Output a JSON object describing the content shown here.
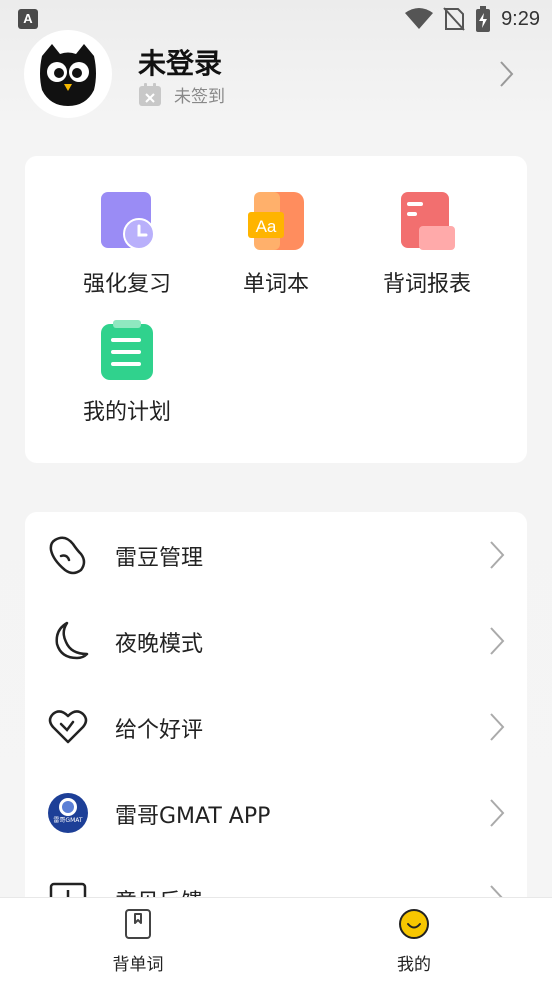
{
  "status_bar": {
    "time": "9:29",
    "app_icon": "A",
    "icons": [
      "wifi-icon",
      "no-sim-icon",
      "battery-charging-icon"
    ]
  },
  "profile": {
    "name": "未登录",
    "checkin_label": "未签到",
    "avatar_icon": "owl-avatar"
  },
  "quick_actions": [
    {
      "label": "强化复习",
      "icon": "review-clock-icon",
      "color": "#8f7ff0"
    },
    {
      "label": "单词本",
      "icon": "wordbook-icon",
      "badge": "Aa",
      "color": "#ff8a5c"
    },
    {
      "label": "背词报表",
      "icon": "report-icon",
      "color": "#f26b6b"
    },
    {
      "label": "我的计划",
      "icon": "plan-clipboard-icon",
      "color": "#2fd08a"
    }
  ],
  "menu": [
    {
      "label": "雷豆管理",
      "icon": "bean-icon"
    },
    {
      "label": "夜晚模式",
      "icon": "moon-icon"
    },
    {
      "label": "给个好评",
      "icon": "heart-icon"
    },
    {
      "label": "雷哥GMAT APP",
      "icon": "leige-gmat-logo",
      "logo_text": "雷哥GMAT"
    },
    {
      "label": "意见反馈",
      "icon": "feedback-icon"
    }
  ],
  "tabs": [
    {
      "label": "背单词",
      "icon": "wordcard-icon",
      "active": false
    },
    {
      "label": "我的",
      "icon": "smiley-icon",
      "active": true
    }
  ],
  "colors": {
    "accent": "#f7c600",
    "card": "#ffffff",
    "background": "#f5f5f5"
  }
}
